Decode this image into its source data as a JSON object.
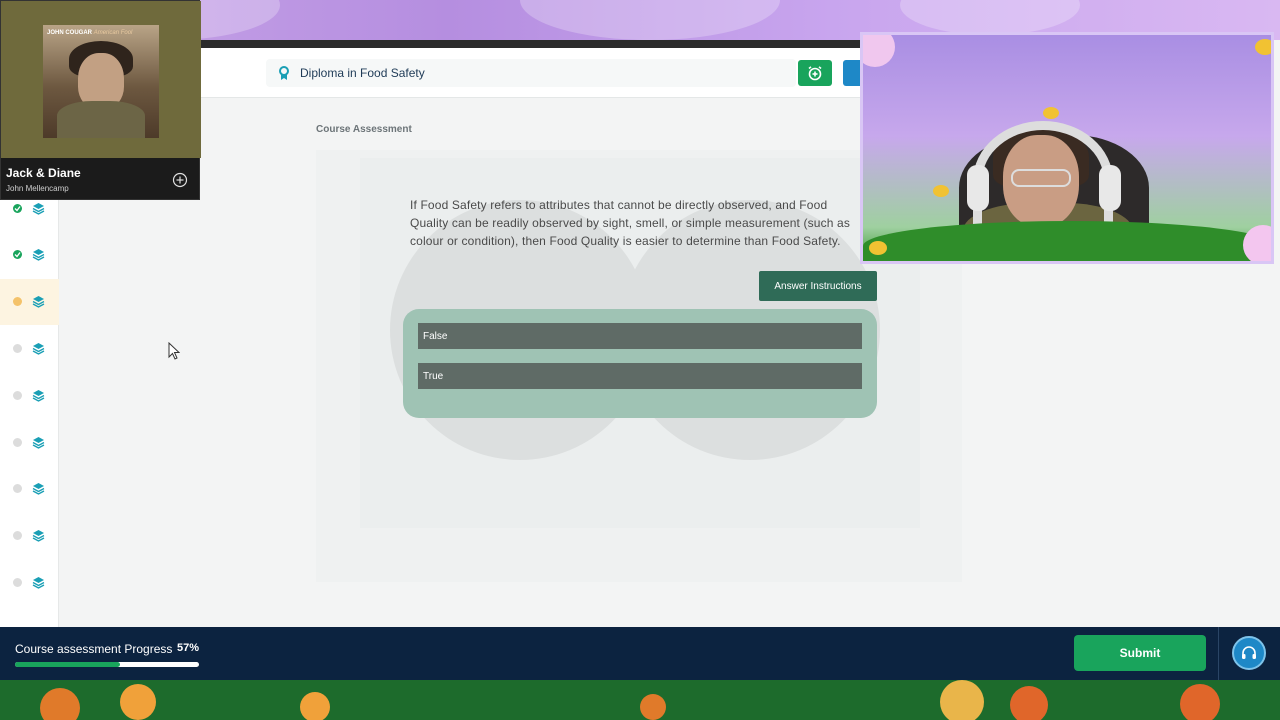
{
  "course": {
    "title": "Diploma in Food Safety",
    "section_label": "Course Assessment"
  },
  "question": {
    "text": "If Food Safety refers to attributes that cannot be directly observed, and Food Quality can be readily observed by sight, smell, or simple measurement (such as colour or condition), then Food Quality is easier to determine than Food Safety.",
    "answer_instructions_label": "Answer Instructions",
    "options": [
      "False",
      "True"
    ]
  },
  "sidebar": {
    "items": [
      {
        "status": "done"
      },
      {
        "status": "done"
      },
      {
        "status": "current"
      },
      {
        "status": "todo"
      },
      {
        "status": "todo"
      },
      {
        "status": "todo"
      },
      {
        "status": "todo"
      },
      {
        "status": "todo"
      },
      {
        "status": "todo"
      }
    ]
  },
  "footer": {
    "progress_label": "Course assessment Progress",
    "progress_percent_text": "57%",
    "progress_value": 0.57,
    "submit_label": "Submit"
  },
  "music": {
    "album_artist": "JOHN COUGAR",
    "album_title": "American Fool",
    "track_title": "Jack & Diane",
    "track_artist": "John Mellencamp"
  },
  "colors": {
    "accent_green": "#19a45c",
    "footer_navy": "#0c2340",
    "option_panel": "#9fc3b4",
    "option_bg": "#5f6b66",
    "instructions_btn": "#2f6b57"
  },
  "icons": {
    "course": "ribbon-icon",
    "alarm": "alarm-add-icon",
    "sidebar_item": "layers-icon",
    "help": "headset-icon",
    "music_add": "plus-circle-icon"
  }
}
